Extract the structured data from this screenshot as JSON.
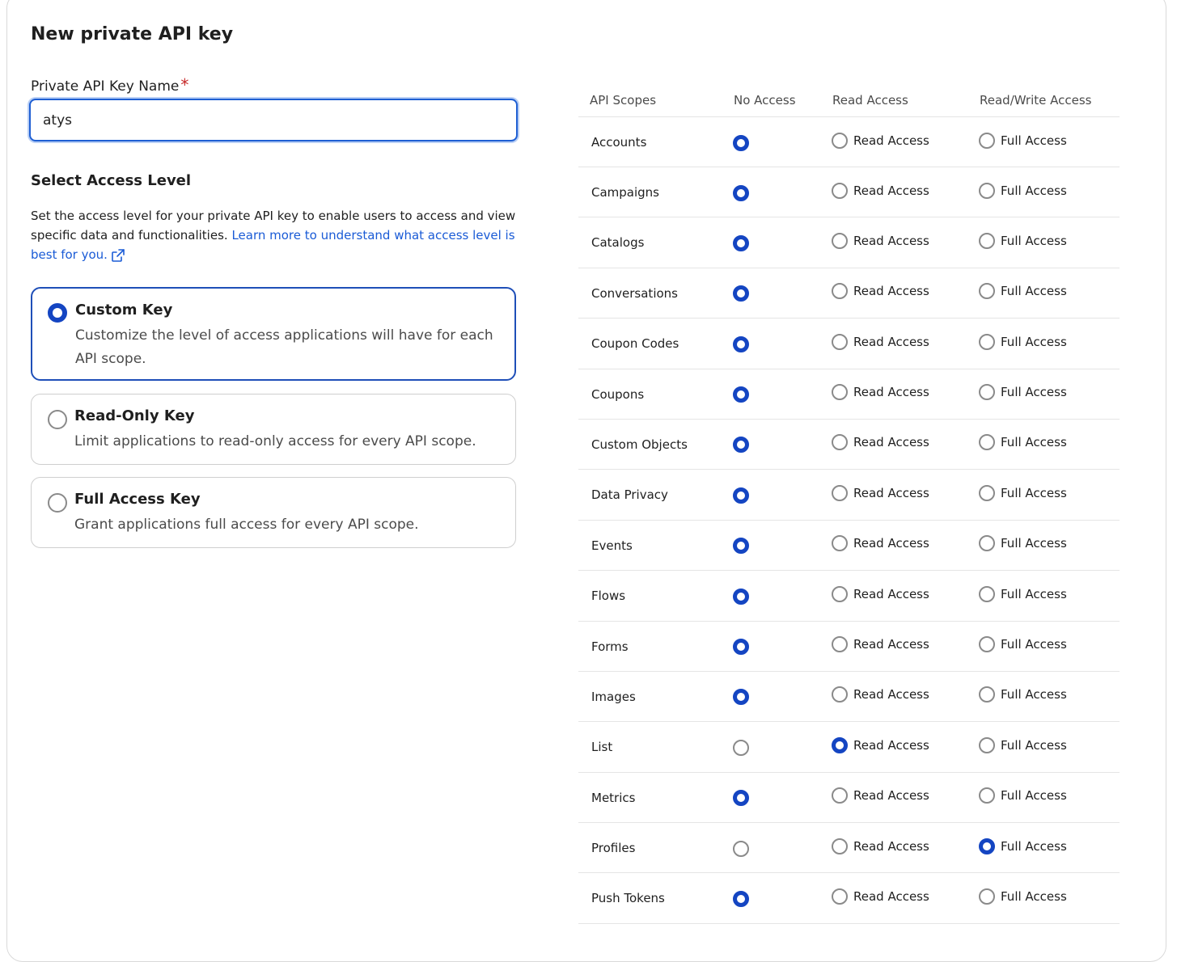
{
  "title": "New private API key",
  "name_field": {
    "label": "Private API Key Name",
    "required_mark": "*",
    "value": "atys"
  },
  "access_level": {
    "title": "Select Access Level",
    "description": "Set the access level for your private API key to enable users to access and view specific data and functionalities.",
    "link_text": "Learn more to understand what access level is best for you.",
    "options": [
      {
        "title": "Custom Key",
        "description": "Customize the level of access applications will have for each API scope.",
        "selected": true
      },
      {
        "title": "Read-Only Key",
        "description": "Limit applications to read-only access for every API scope.",
        "selected": false
      },
      {
        "title": "Full Access Key",
        "description": "Grant applications full access for every API scope.",
        "selected": false
      }
    ]
  },
  "scopes_table": {
    "headers": [
      "API Scopes",
      "No Access",
      "Read Access",
      "Read/Write Access"
    ],
    "read_label": "Read Access",
    "full_label": "Full Access",
    "rows": [
      {
        "name": "Accounts",
        "selected": "none"
      },
      {
        "name": "Campaigns",
        "selected": "none"
      },
      {
        "name": "Catalogs",
        "selected": "none"
      },
      {
        "name": "Conversations",
        "selected": "none"
      },
      {
        "name": "Coupon Codes",
        "selected": "none"
      },
      {
        "name": "Coupons",
        "selected": "none"
      },
      {
        "name": "Custom Objects",
        "selected": "none"
      },
      {
        "name": "Data Privacy",
        "selected": "none"
      },
      {
        "name": "Events",
        "selected": "none"
      },
      {
        "name": "Flows",
        "selected": "none"
      },
      {
        "name": "Forms",
        "selected": "none"
      },
      {
        "name": "Images",
        "selected": "none"
      },
      {
        "name": "List",
        "selected": "read"
      },
      {
        "name": "Metrics",
        "selected": "none"
      },
      {
        "name": "Profiles",
        "selected": "full"
      },
      {
        "name": "Push Tokens",
        "selected": "none"
      }
    ]
  },
  "colors": {
    "accent": "#1445c2",
    "link": "#1a5bd6",
    "required": "#c62828"
  }
}
